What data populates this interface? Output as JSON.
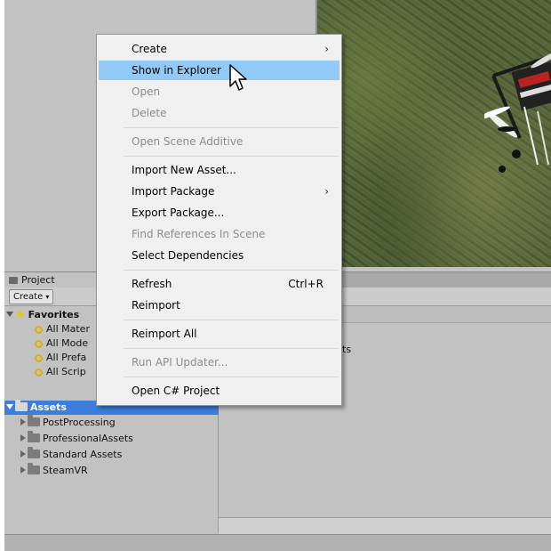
{
  "project": {
    "tab_label": "Project",
    "create_label": "Create",
    "create_caret": "▾",
    "content_text": "ts"
  },
  "tree": {
    "favorites_label": "Favorites",
    "favorites": [
      "All Mater",
      "All Mode",
      "All Prefa",
      "All Scrip"
    ],
    "assets_label": "Assets",
    "folders": [
      "PostProcessing",
      "ProfessionalAssets",
      "Standard Assets",
      "SteamVR"
    ]
  },
  "menu": {
    "items": [
      {
        "label": "Create",
        "submenu": "›",
        "enabled": true
      },
      {
        "label": "Show in Explorer",
        "enabled": true,
        "highlighted": true
      },
      {
        "label": "Open",
        "enabled": false
      },
      {
        "label": "Delete",
        "enabled": false
      },
      {
        "label": "Open Scene Additive",
        "enabled": false
      },
      {
        "label": "Import New Asset...",
        "enabled": true
      },
      {
        "label": "Import Package",
        "submenu": "›",
        "enabled": true
      },
      {
        "label": "Export Package...",
        "enabled": true
      },
      {
        "label": "Find References In Scene",
        "enabled": false
      },
      {
        "label": "Select Dependencies",
        "enabled": true
      },
      {
        "label": "Refresh",
        "shortcut": "Ctrl+R",
        "enabled": true
      },
      {
        "label": "Reimport",
        "enabled": true
      },
      {
        "label": "Reimport All",
        "enabled": true
      },
      {
        "label": "Run API Updater...",
        "enabled": false
      },
      {
        "label": "Open C# Project",
        "enabled": true
      }
    ]
  },
  "colors": {
    "selection": "#3d7ddb",
    "menu_highlight": "#91c9f7",
    "panel_bg": "#c2c2c2"
  }
}
